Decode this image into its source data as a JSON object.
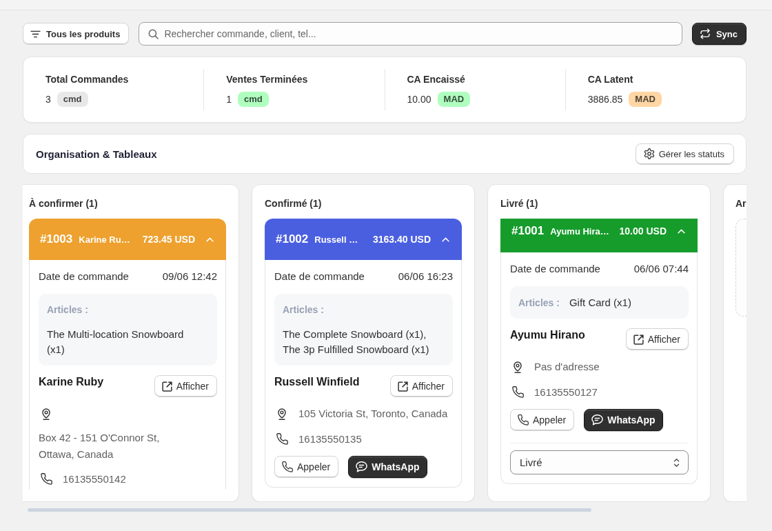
{
  "toolbar": {
    "filter_button": "Tous les produits",
    "search": {
      "placeholder": "Rechercher commande, client, tel..."
    },
    "sync_button": "Sync"
  },
  "stats": [
    {
      "label": "Total Commandes",
      "value": "3",
      "unit": "cmd",
      "color": "#e8e8e8"
    },
    {
      "label": "Ventes Terminées",
      "value": "1",
      "unit": "cmd",
      "color": "#affebf"
    },
    {
      "label": "CA Encaissé",
      "value": "10.00",
      "unit": "MAD",
      "color": "#affebf"
    },
    {
      "label": "CA Latent",
      "value": "3886.85",
      "unit": "MAD",
      "color": "#ffd6a4"
    }
  ],
  "board": {
    "title": "Organisation & Tableaux",
    "manage_button": "Gérer les statuts",
    "columns": [
      {
        "title": "À confirmer (1)",
        "orders": [
          {
            "number": "#1003",
            "customer_short": "Karine Ru…",
            "total": "723.45 USD",
            "color": "#eea12e",
            "expanded": true,
            "date_label": "Date de commande",
            "date": "09/06 12:42",
            "articles_label": "Articles :",
            "articles": "The Multi-location Snowboard (x1)",
            "customer": "Karine Ruby",
            "view_button": "Afficher",
            "address": "Box 42 - 151 O'Connor St, Ottawa, Canada",
            "phone": "16135550142"
          }
        ]
      },
      {
        "title": "Confirmé (1)",
        "orders": [
          {
            "number": "#1002",
            "customer_short": "Russell …",
            "total": "3163.40 USD",
            "color": "#4a5fe0",
            "expanded": true,
            "date_label": "Date de commande",
            "date": "06/06 16:23",
            "articles_label": "Articles :",
            "articles": "The Complete Snowboard (x1), The 3p Fulfilled Snowboard (x1)",
            "customer": "Russell Winfield",
            "view_button": "Afficher",
            "address": "105 Victoria St, Toronto, Canada",
            "phone": "16135550135",
            "call_button": "Appeler",
            "whatsapp_button": "WhatsApp"
          }
        ]
      },
      {
        "title": "Livré (1)",
        "orders": [
          {
            "number": "#1001",
            "customer_short": "Ayumu Hira…",
            "total": "10.00 USD",
            "color": "#169c2b",
            "expanded": true,
            "date_label": "Date de commande",
            "date": "06/06 07:44",
            "articles_label": "Articles :",
            "articles": "Gift Card (x1)",
            "customer": "Ayumu Hirano",
            "view_button": "Afficher",
            "address": "Pas d'adresse",
            "phone": "16135550127",
            "call_button": "Appeler",
            "whatsapp_button": "WhatsApp",
            "status_select": {
              "value": "Livré"
            }
          }
        ]
      },
      {
        "title": "Ar"
      }
    ]
  }
}
